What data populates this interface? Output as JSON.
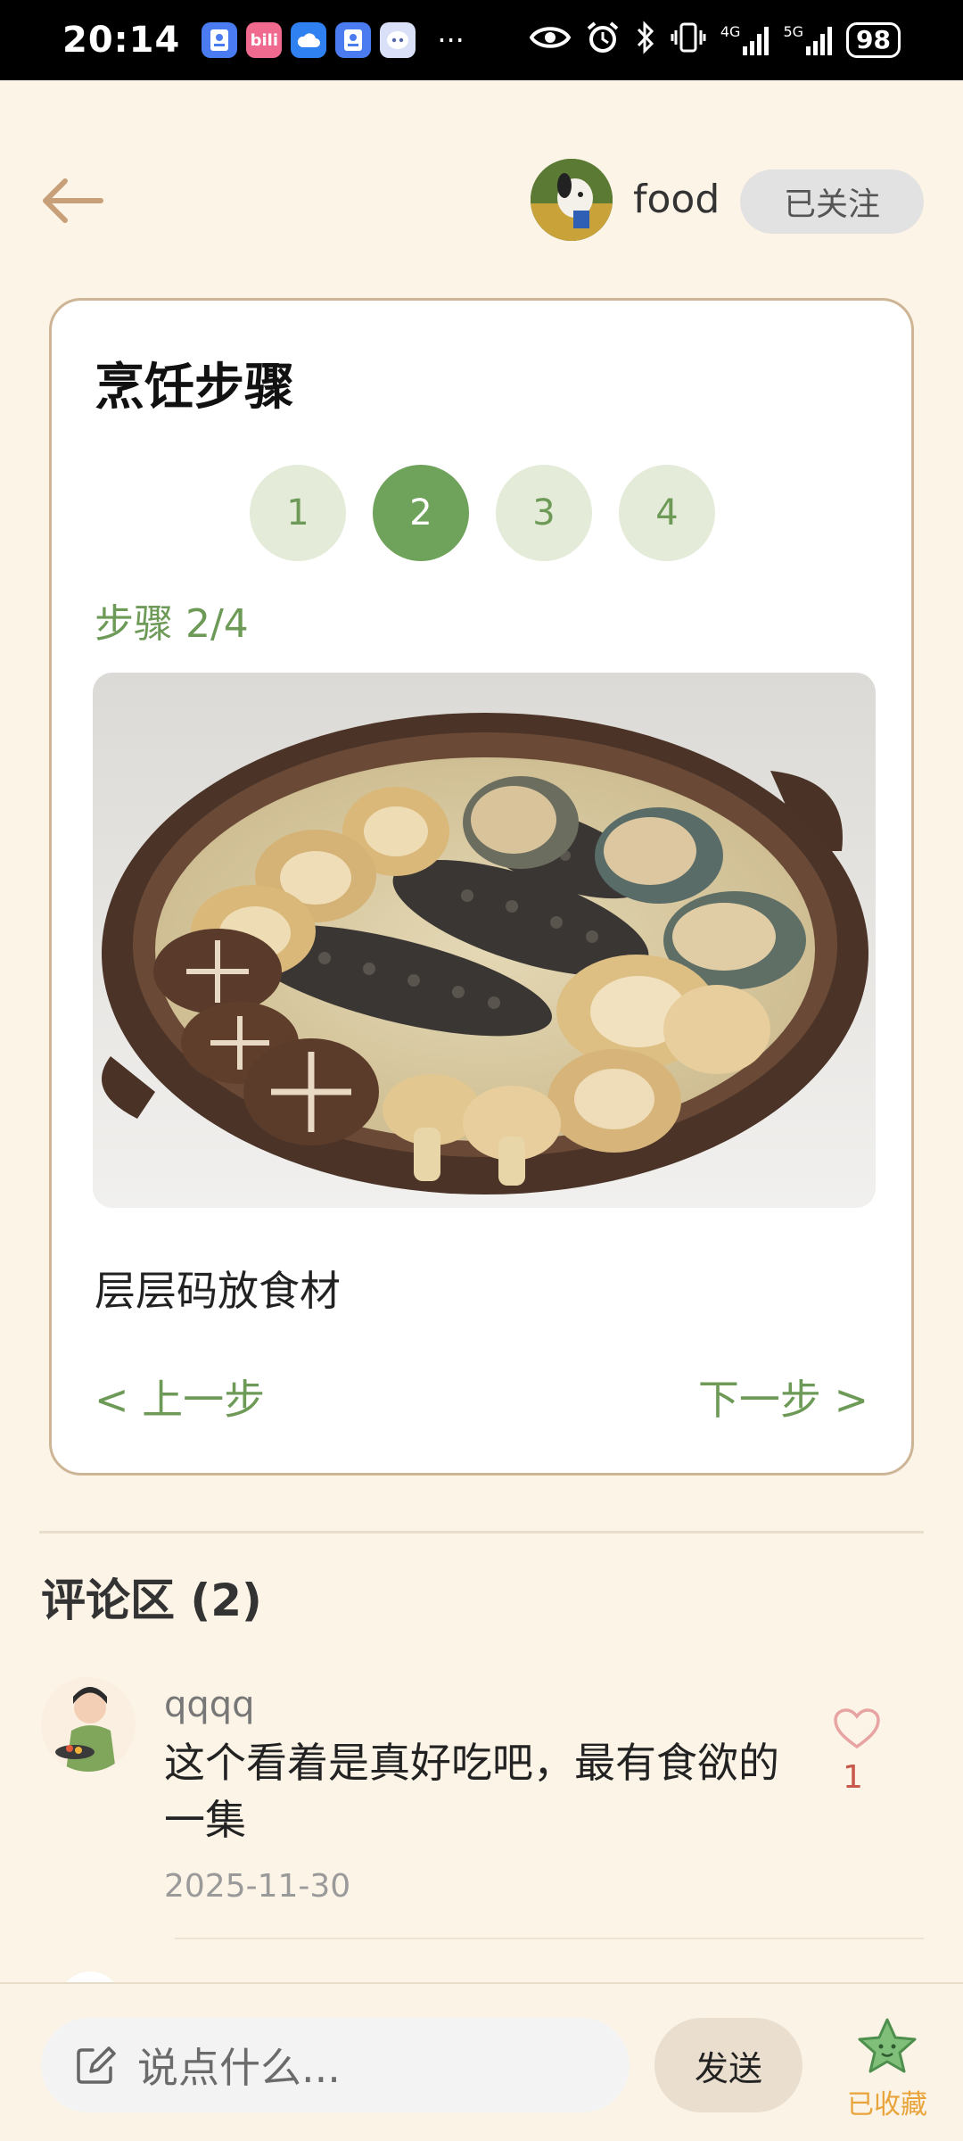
{
  "status_bar": {
    "time": "20:14",
    "apps": [
      {
        "icon": "id-card-icon",
        "color": "#4A7BF0"
      },
      {
        "icon": "bilibili-icon",
        "color": "#F06A8F",
        "text": "bili"
      },
      {
        "icon": "cloud-icon",
        "color": "#2F80F0"
      },
      {
        "icon": "id-card-icon",
        "color": "#4A7BF0"
      },
      {
        "icon": "assistant-icon",
        "color": "#D9E0F7"
      }
    ],
    "more": "···",
    "network_1": "4G",
    "network_2": "5G",
    "battery": "98"
  },
  "header": {
    "author_name": "food",
    "follow_label": "已关注"
  },
  "steps_card": {
    "title": "烹饪步骤",
    "steps": [
      "1",
      "2",
      "3",
      "4"
    ],
    "active_step": 2,
    "step_label": "步骤 2/4",
    "description": "层层码放食材",
    "prev_label": "< 上一步",
    "next_label": "下一步 >"
  },
  "comments": {
    "title": "评论区 (2)",
    "items": [
      {
        "user": "qqqq",
        "text": "这个看着是真好吃吧，最有食欲的一集",
        "date": "2025-11-30",
        "likes": "1"
      }
    ]
  },
  "bottom_bar": {
    "input_placeholder": "说点什么...",
    "send_label": "发送",
    "favorite_label": "已收藏"
  },
  "colors": {
    "background": "#FCF4E7",
    "accent_green": "#6FA25A",
    "card_border": "#CDB596",
    "like_red": "#C8584B",
    "favorite_orange": "#E8A43A"
  }
}
